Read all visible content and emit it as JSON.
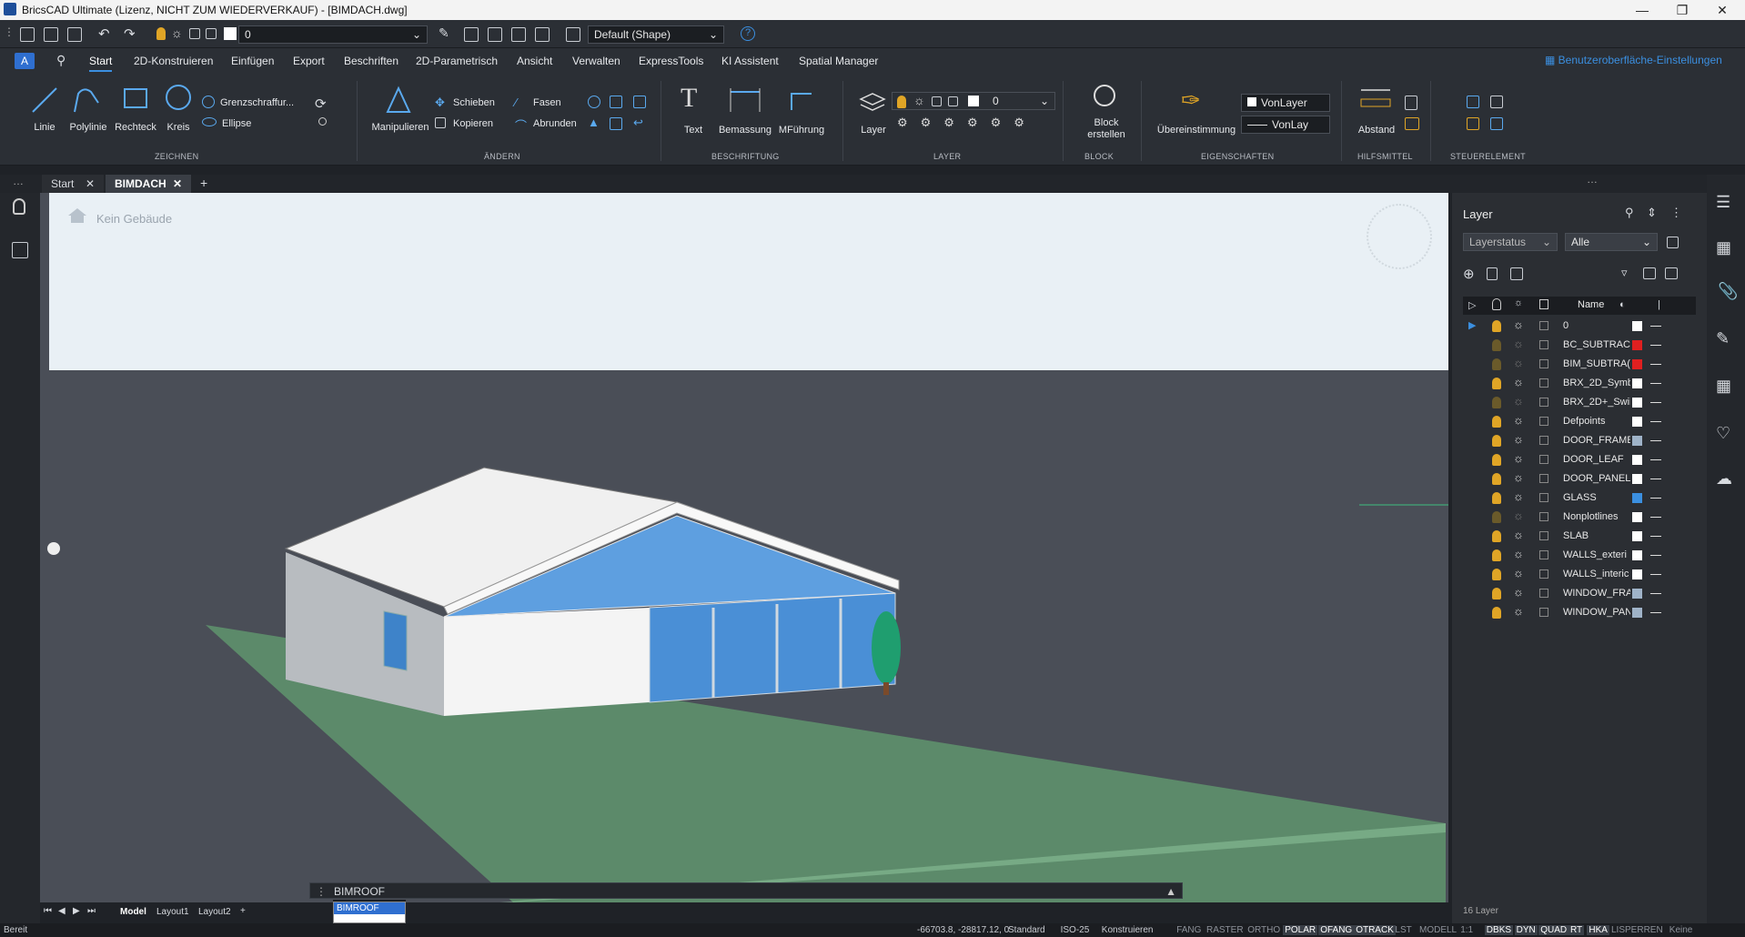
{
  "title": "BricsCAD Ultimate (Lizenz, NICHT ZUM WIEDERVERKAUF) - [BIMDACH.dwg]",
  "qat": {
    "layer_value": "0",
    "style_value": "Default (Shape)"
  },
  "menu": [
    "Start",
    "2D-Konstruieren",
    "Einfügen",
    "Export",
    "Beschriften",
    "2D-Parametrisch",
    "Ansicht",
    "Verwalten",
    "ExpressTools",
    "KI Assistent",
    "Spatial Manager"
  ],
  "ui_settings": "Benutzeroberfläche-Einstellungen",
  "ribbon": {
    "draw": {
      "linie": "Linie",
      "polylinie": "Polylinie",
      "rechteck": "Rechteck",
      "kreis": "Kreis",
      "grenz": "Grenzschraffur...",
      "ellipse": "Ellipse",
      "group": "ZEICHNEN"
    },
    "modify": {
      "manip": "Manipulieren",
      "schieben": "Schieben",
      "kopieren": "Kopieren",
      "fasen": "Fasen",
      "abrunden": "Abrunden",
      "group": "ÄNDERN"
    },
    "annot": {
      "text": "Text",
      "bemassung": "Bemassung",
      "mfuehrung": "MFührung",
      "group": "BESCHRIFTUNG"
    },
    "layer": {
      "label": "Layer",
      "current": "0",
      "group": "LAYER"
    },
    "block": {
      "label1": "Block",
      "label2": "erstellen",
      "group": "BLOCK"
    },
    "props": {
      "match": "Übereinstimmung",
      "color": "VonLayer",
      "ltype": "VonLay",
      "group": "EIGENSCHAFTEN"
    },
    "tools": {
      "abstand": "Abstand",
      "group": "HILFSMITTEL"
    },
    "control": {
      "group": "STEUERELEMENT"
    }
  },
  "doc_tabs": [
    "Start",
    "BIMDACH"
  ],
  "viewport": {
    "building": "Kein Gebäude"
  },
  "command": {
    "input": "BIMROOF",
    "suggestion": "BIMROOF"
  },
  "layer_panel": {
    "title": "Layer",
    "filter1": "Layerstatus",
    "filter2": "Alle",
    "col_name": "Name",
    "rows": [
      {
        "name": "0",
        "color": "#ffffff",
        "current": true
      },
      {
        "name": "BC_SUBTRAC'",
        "color": "#e02020"
      },
      {
        "name": "BIM_SUBTRA(",
        "color": "#e02020"
      },
      {
        "name": "BRX_2D_Symb",
        "color": "#ffffff"
      },
      {
        "name": "BRX_2D+_Swii",
        "color": "#ffffff"
      },
      {
        "name": "Defpoints",
        "color": "#ffffff"
      },
      {
        "name": "DOOR_FRAME",
        "color": "#9fb3c8"
      },
      {
        "name": "DOOR_LEAF",
        "color": "#ffffff"
      },
      {
        "name": "DOOR_PANEL",
        "color": "#ffffff"
      },
      {
        "name": "GLASS",
        "color": "#3b8fe0"
      },
      {
        "name": "Nonplotlines",
        "color": "#ffffff"
      },
      {
        "name": "SLAB",
        "color": "#ffffff"
      },
      {
        "name": "WALLS_exteri",
        "color": "#ffffff"
      },
      {
        "name": "WALLS_interic",
        "color": "#ffffff"
      },
      {
        "name": "WINDOW_FRA",
        "color": "#9fb3c8"
      },
      {
        "name": "WINDOW_PAN",
        "color": "#9fb3c8"
      }
    ],
    "count": "16 Layer"
  },
  "layout_tabs": [
    "Model",
    "Layout1",
    "Layout2"
  ],
  "status": {
    "ready": "Bereit",
    "coords": "-66703.8, -28817.12, 0",
    "items": [
      {
        "t": "Standard",
        "on": false
      },
      {
        "t": "ISO-25",
        "on": false
      },
      {
        "t": "Konstruieren",
        "on": false
      },
      {
        "t": "FANG",
        "on": false
      },
      {
        "t": "RASTER",
        "on": false
      },
      {
        "t": "ORTHO",
        "on": false
      },
      {
        "t": "POLAR",
        "on": true
      },
      {
        "t": "OFANG",
        "on": true
      },
      {
        "t": "OTRACK",
        "on": true
      },
      {
        "t": "LST",
        "on": false
      },
      {
        "t": "MODELL",
        "on": false
      },
      {
        "t": "1:1",
        "on": false
      },
      {
        "t": "DBKS",
        "on": true
      },
      {
        "t": "DYN",
        "on": true
      },
      {
        "t": "QUAD",
        "on": true
      },
      {
        "t": "RT",
        "on": true
      },
      {
        "t": "HKA",
        "on": true
      },
      {
        "t": "LISPERREN",
        "on": false
      },
      {
        "t": "Keine",
        "on": false
      }
    ]
  }
}
